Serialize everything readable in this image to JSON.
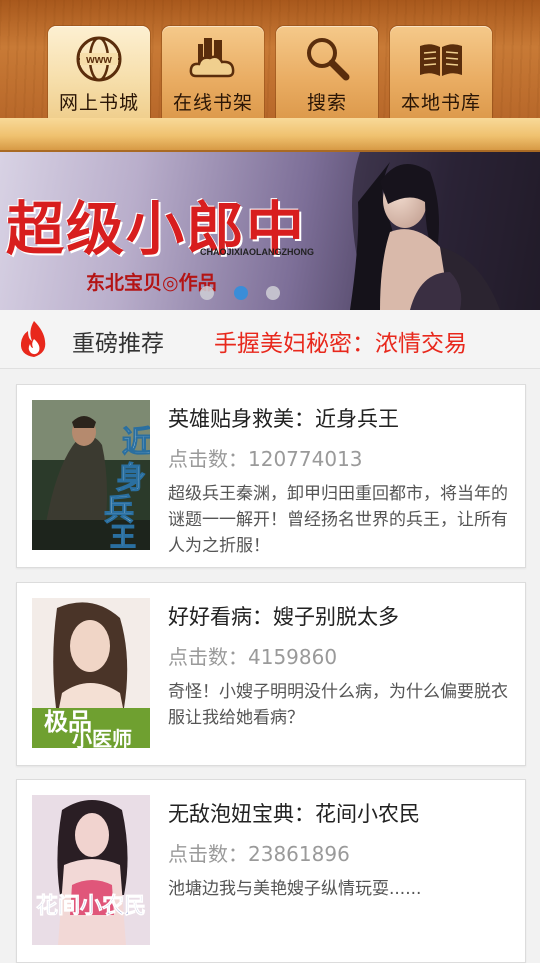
{
  "tabs": [
    {
      "label": "网上书城",
      "icon": "www-globe-icon",
      "active": true
    },
    {
      "label": "在线书架",
      "icon": "cloud-books-icon",
      "active": false
    },
    {
      "label": "搜索",
      "icon": "magnifier-icon",
      "active": false
    },
    {
      "label": "本地书库",
      "icon": "open-book-icon",
      "active": false
    }
  ],
  "banner": {
    "title": "超级小郎中",
    "pinyin": "CHAOJIXIAOLANGZHONG",
    "author": "东北宝贝◎作品",
    "slide_count": 3,
    "active_slide": 2
  },
  "recommend": {
    "label": "重磅推荐",
    "link": "手握美妇秘密：浓情交易",
    "icon": "flame-icon"
  },
  "books": [
    {
      "title": "英雄贴身救美：近身兵王",
      "clicks": "点击数：120774013",
      "desc": "超级兵王秦渊，卸甲归田重回都市，将当年的谜题一一解开！曾经扬名世界的兵王，让所有人为之折服！",
      "cover_text": "近身兵王"
    },
    {
      "title": "好好看病：嫂子别脱太多",
      "clicks": "点击数：4159860",
      "desc": "奇怪！小嫂子明明没什么病，为什么偏要脱衣服让我给她看病？",
      "cover_text": "极品小医师"
    },
    {
      "title": "无敌泡妞宝典：花间小农民",
      "clicks": "点击数：23861896",
      "desc": "池塘边我与美艳嫂子纵情玩耍......",
      "cover_text": "花间小农民"
    }
  ],
  "colors": {
    "accent_red": "#e8281c",
    "active_dot": "#2b8fe0",
    "wood": "#c87a36"
  }
}
